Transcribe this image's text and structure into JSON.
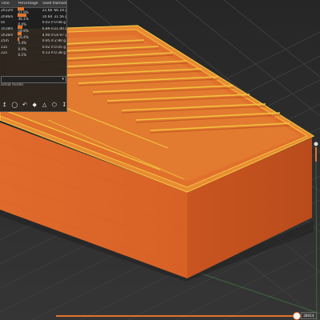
{
  "legend": {
    "headers": [
      "Time",
      "Percentage",
      "Used filament"
    ],
    "rows": [
      {
        "time": "2h12m",
        "pct": "27.9%",
        "pct_value": 0.279,
        "length": "21.66 m",
        "weight": "66.19 g"
      },
      {
        "time": "2h46m",
        "pct": "36.1%",
        "pct_value": 0.361,
        "length": "10.64 m",
        "weight": "31.56 g"
      },
      {
        "time": "0s",
        "pct": "0.0%",
        "pct_value": 0.0,
        "length": "0.03 m",
        "weight": "0.08 g"
      },
      {
        "time": "1h18m",
        "pct": "18.9%",
        "pct_value": 0.189,
        "length": "6.89 m",
        "weight": "21.00 g"
      },
      {
        "time": "1h16m",
        "pct": "16.4%",
        "pct_value": 0.164,
        "length": "4.90 m",
        "weight": "14.97 g"
      },
      {
        "time": "25m",
        "pct": "5.4%",
        "pct_value": 0.054,
        "length": "0.95 m",
        "weight": "2.90 g"
      },
      {
        "time": "13s",
        "pct": "0.0%",
        "pct_value": 0.0,
        "length": "0.02 m",
        "weight": "0.05 g"
      },
      {
        "time": "22s",
        "pct": "0.1%",
        "pct_value": 0.001,
        "length": "0.13 m",
        "weight": "0.38 g"
      }
    ],
    "mode_text": "ormal mode)"
  },
  "slider": {
    "value": "28414",
    "fraction": 0.99
  },
  "colors": {
    "accent": "#e2752b",
    "model": "#e2752b",
    "bed": "#3a3a3a",
    "grid_green": "#4a8c4a"
  }
}
